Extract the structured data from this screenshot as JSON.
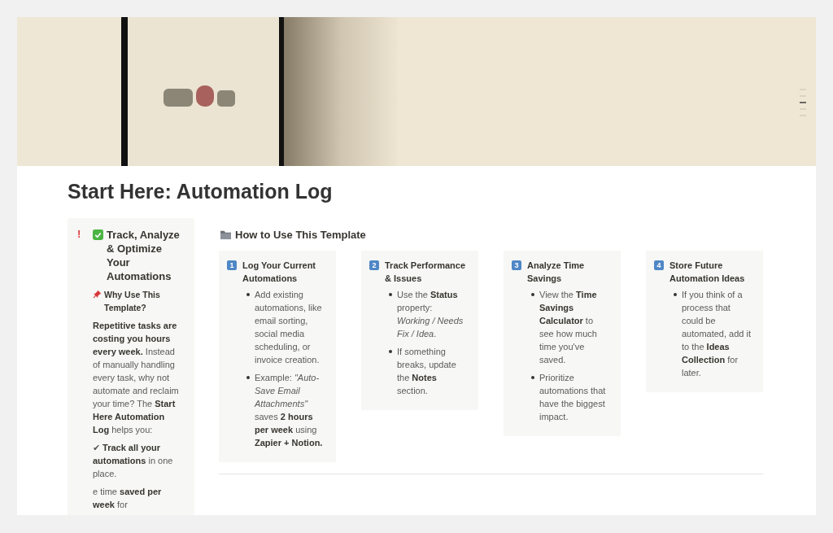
{
  "title": "Start Here: Automation Log",
  "callout": {
    "icon": "!",
    "heading": "Track, Analyze & Optimize Your Automations",
    "subheading": "Why Use This Template?",
    "paragraph": "**Repetitive tasks are costing you hours every week.** Instead of manually handling every task, why not automate and reclaim your time? The **Start Here Automation Log** helps you:",
    "checklist": [
      "✔ **Track all your automations** in one place.",
      "e time **saved per week** for"
    ]
  },
  "section": {
    "heading": "How to Use This Template",
    "steps": [
      {
        "number": "1",
        "title": "Log Your Current Automations",
        "bullets": [
          "Add existing automations, like email sorting, social media scheduling, or invoice creation.",
          "Example: *\"Auto-Save Email Attachments\"* saves **2 hours per week** using **Zapier + Notion.**"
        ]
      },
      {
        "number": "2",
        "title": "Track Performance & Issues",
        "bullets": [
          "Use the **Status** property: *Working / Needs Fix / Idea*.",
          "If something breaks, update the **Notes** section."
        ]
      },
      {
        "number": "3",
        "title": "Analyze Time Savings",
        "bullets": [
          "View the **Time Savings Calculator** to see how much time you've saved.",
          "Prioritize automations that have the biggest impact."
        ]
      },
      {
        "number": "4",
        "title": "Store Future Automation Ideas",
        "bullets": [
          "If you think of a process that could be automated, add it to the **Ideas Collection** for later."
        ]
      }
    ]
  }
}
